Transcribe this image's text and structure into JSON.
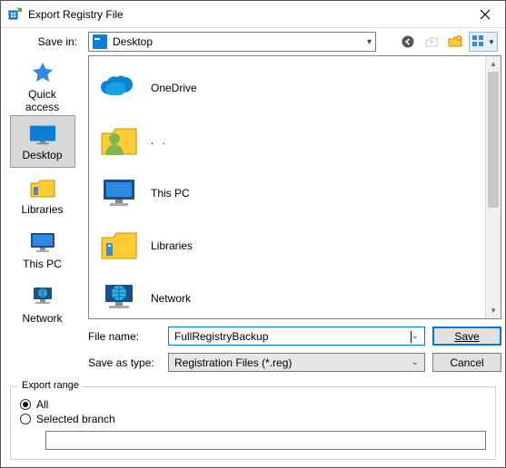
{
  "title": "Export Registry File",
  "toolbar": {
    "savein_label": "Save in:",
    "savein_value": "Desktop",
    "back_icon": "back-icon",
    "up_icon": "up-folder-icon",
    "newfolder_icon": "new-folder-icon",
    "view_icon": "view-menu-icon"
  },
  "sidebar": {
    "items": [
      {
        "label": "Quick access"
      },
      {
        "label": "Desktop"
      },
      {
        "label": "Libraries"
      },
      {
        "label": "This PC"
      },
      {
        "label": "Network"
      }
    ],
    "selected": 1
  },
  "filelist": {
    "items": [
      {
        "label": "OneDrive",
        "icon": "onedrive"
      },
      {
        "label": ". .",
        "icon": "user"
      },
      {
        "label": "This PC",
        "icon": "thispc"
      },
      {
        "label": "Libraries",
        "icon": "libraries"
      },
      {
        "label": "Network",
        "icon": "network"
      }
    ]
  },
  "form": {
    "filename_label": "File name:",
    "filename_value": "FullRegistryBackup",
    "saveastype_label": "Save as type:",
    "saveastype_value": "Registration Files (*.reg)",
    "save_btn": "Save",
    "cancel_btn": "Cancel"
  },
  "export_range": {
    "legend": "Export range",
    "all_label": "All",
    "selected_branch_label": "Selected branch",
    "selected": "all",
    "branch_value": ""
  }
}
